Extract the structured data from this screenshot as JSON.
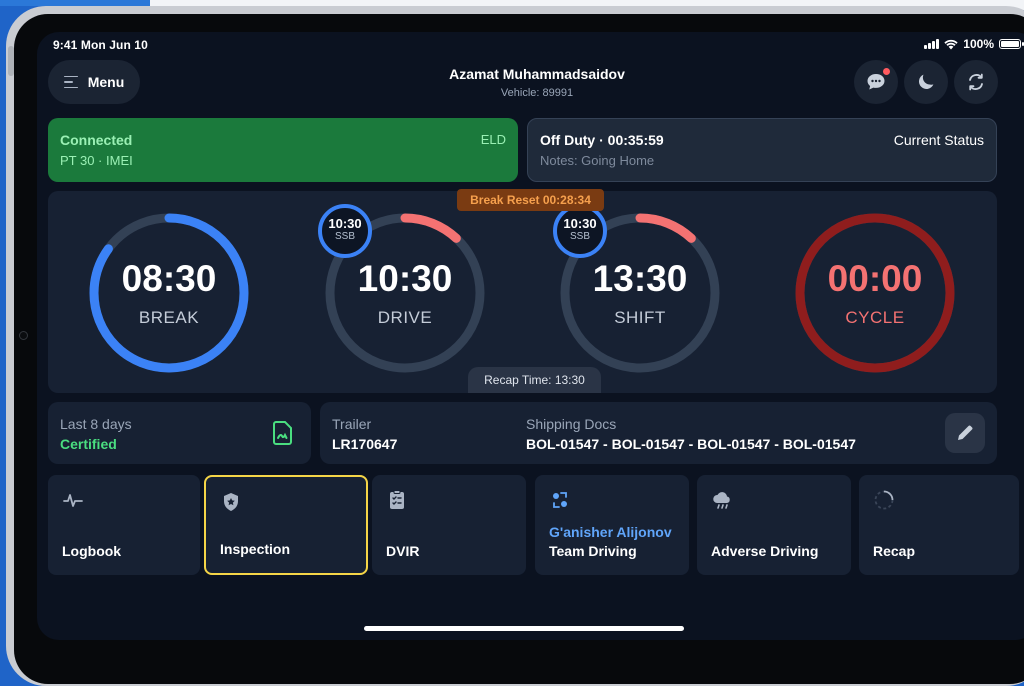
{
  "status_bar": {
    "time": "9:41  Mon Jun 10",
    "battery": "100%"
  },
  "header": {
    "menu_label": "Menu",
    "driver_name": "Azamat Muhammadsaidov",
    "vehicle": "Vehicle: 89991"
  },
  "eld": {
    "state": "Connected",
    "type": "ELD",
    "device": "PT 30 · IMEI"
  },
  "duty": {
    "status": "Off Duty · 00:35:59",
    "caption": "Current Status",
    "notes": "Notes: Going Home"
  },
  "timers": {
    "break_reset": "Break Reset  00:28:34",
    "recap_time": "Recap Time: 13:30",
    "gauges": [
      {
        "time": "08:30",
        "label": "BREAK",
        "progress": 0.85,
        "color": "#3b82f6"
      },
      {
        "time": "10:30",
        "label": "DRIVE",
        "progress": 0.12,
        "color": "#f47272",
        "ssb_time": "10:30",
        "ssb_label": "SSB"
      },
      {
        "time": "13:30",
        "label": "SHIFT",
        "progress": 0.12,
        "color": "#f47272",
        "ssb_time": "10:30",
        "ssb_label": "SSB"
      },
      {
        "time": "00:00",
        "label": "CYCLE",
        "progress": 1.0,
        "color": "#8f1d1d"
      }
    ]
  },
  "certification": {
    "title": "Last 8 days",
    "status": "Certified"
  },
  "trip": {
    "trailer_label": "Trailer",
    "trailer_value": "LR170647",
    "docs_label": "Shipping Docs",
    "docs_value": "BOL-01547 - BOL-01547 - BOL-01547 - BOL-01547"
  },
  "tiles": [
    {
      "label": "Logbook",
      "icon": "pulse-icon"
    },
    {
      "label": "Inspection",
      "icon": "shield-icon",
      "selected": true
    },
    {
      "label": "DVIR",
      "icon": "clipboard-icon"
    },
    {
      "label": "Team Driving",
      "sublabel": "G'anisher Alijonov",
      "icon": "team-swap-icon"
    },
    {
      "label": "Adverse Driving",
      "icon": "storm-cloud-icon"
    },
    {
      "label": "Recap",
      "icon": "progress-circle-icon"
    }
  ]
}
